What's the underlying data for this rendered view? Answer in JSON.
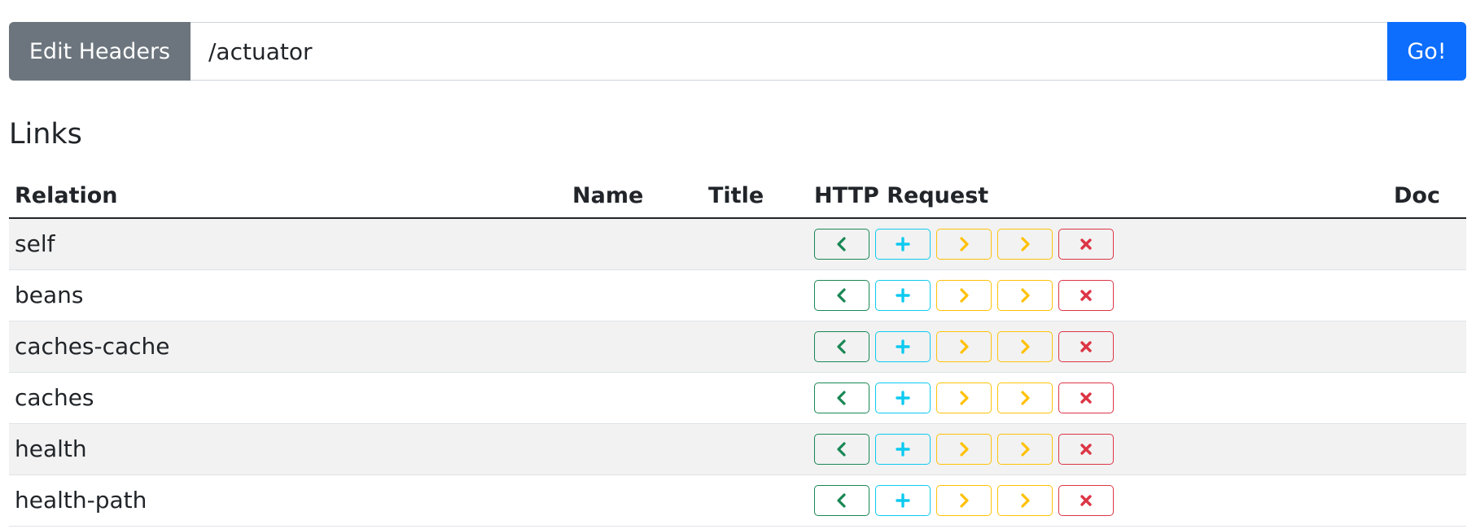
{
  "toolbar": {
    "edit_headers_label": "Edit Headers",
    "url_value": "/actuator",
    "go_label": "Go!"
  },
  "links": {
    "title": "Links",
    "columns": {
      "relation": "Relation",
      "name": "Name",
      "title": "Title",
      "http_request": "HTTP Request",
      "doc": "Doc"
    },
    "rows": [
      {
        "relation": "self",
        "name": "",
        "title": "",
        "doc": ""
      },
      {
        "relation": "beans",
        "name": "",
        "title": "",
        "doc": ""
      },
      {
        "relation": "caches-cache",
        "name": "",
        "title": "",
        "doc": ""
      },
      {
        "relation": "caches",
        "name": "",
        "title": "",
        "doc": ""
      },
      {
        "relation": "health",
        "name": "",
        "title": "",
        "doc": ""
      },
      {
        "relation": "health-path",
        "name": "",
        "title": "",
        "doc": ""
      }
    ],
    "actions": [
      {
        "key": "get",
        "icon": "chevron-left-icon",
        "color": "#198754"
      },
      {
        "key": "post",
        "icon": "plus-icon",
        "color": "#0dcaf0"
      },
      {
        "key": "put",
        "icon": "chevron-right-icon",
        "color": "#ffc107"
      },
      {
        "key": "patch",
        "icon": "chevron-right-icon",
        "color": "#ffc107"
      },
      {
        "key": "delete",
        "icon": "x-icon",
        "color": "#dc3545"
      }
    ]
  },
  "colors": {
    "secondary": "#6c757d",
    "primary": "#0d6efd",
    "striped_row": "#f2f2f2"
  }
}
